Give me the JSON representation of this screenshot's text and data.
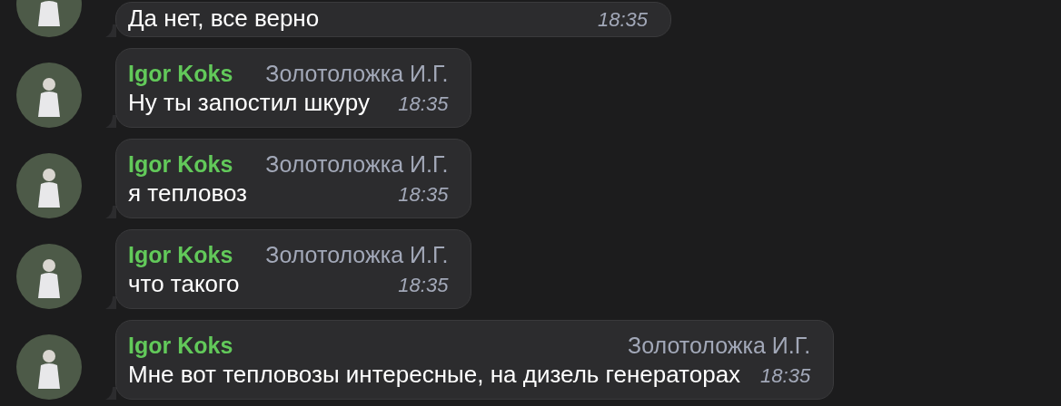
{
  "messages": [
    {
      "text": "Да нет, все верно",
      "time": "18:35",
      "partial": true
    },
    {
      "author": "Igor Koks",
      "signature": "Золотоложка И.Г.",
      "text": "Ну ты запостил шкуру",
      "time": "18:35",
      "partial": false
    },
    {
      "author": "Igor Koks",
      "signature": "Золотоложка И.Г.",
      "text": "я тепловоз",
      "time": "18:35",
      "partial": false
    },
    {
      "author": "Igor Koks",
      "signature": "Золотоложка И.Г.",
      "text": "что такого",
      "time": "18:35",
      "partial": false
    },
    {
      "author": "Igor Koks",
      "signature": "Золотоложка И.Г.",
      "text": "Мне вот тепловозы интересные, на дизель генераторах",
      "time": "18:35",
      "partial": false
    }
  ]
}
